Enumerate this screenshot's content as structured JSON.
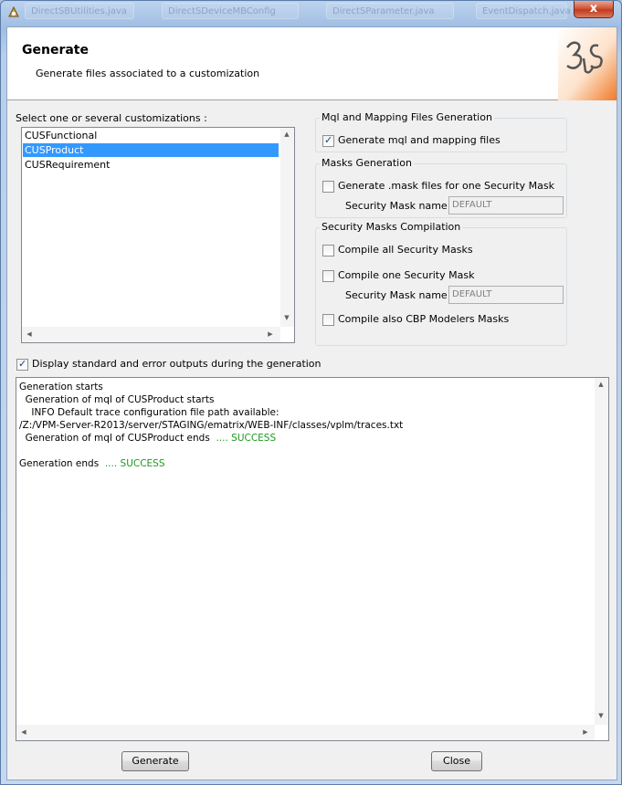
{
  "titlebar": {
    "ghost_tabs": [
      "DirectSBUtilities.java",
      "DirectSDeviceMBConfig",
      "DirectSParameter.java",
      "EventDispatch.java"
    ],
    "close_label": "x"
  },
  "header": {
    "title": "Generate",
    "subtitle": "Generate files associated to a customization",
    "logo_text": "3S"
  },
  "customizations": {
    "label": "Select one or several customizations :",
    "items": [
      {
        "label": "CUSFunctional",
        "selected": false
      },
      {
        "label": "CUSProduct",
        "selected": true
      },
      {
        "label": "CUSRequirement",
        "selected": false
      }
    ]
  },
  "mql_group": {
    "title": "Mql and Mapping Files Generation",
    "generate_label": "Generate mql and mapping files",
    "generate_checked": true
  },
  "masks_group": {
    "title": "Masks Generation",
    "generate_label": "Generate .mask files for one Security Mask",
    "generate_checked": false,
    "mask_name_label": "Security Mask name :",
    "mask_name_value": "DEFAULT"
  },
  "compile_group": {
    "title": "Security Masks Compilation",
    "all_label": "Compile all Security Masks",
    "all_checked": false,
    "one_label": "Compile one Security Mask",
    "one_checked": false,
    "mask_name_label": "Security Mask name :",
    "mask_name_value": "DEFAULT",
    "cbp_label": "Compile also CBP Modelers Masks",
    "cbp_checked": false
  },
  "display_outputs": {
    "label": "Display standard and error outputs during the generation",
    "checked": true
  },
  "console": {
    "lines": [
      {
        "text": "Generation starts",
        "status": ""
      },
      {
        "text": "  Generation of mql of CUSProduct starts",
        "status": ""
      },
      {
        "text": "    INFO Default trace configuration file path available:",
        "status": ""
      },
      {
        "text": "/Z:/VPM-Server-R2013/server/STAGING/ematrix/WEB-INF/classes/vplm/traces.txt",
        "status": ""
      },
      {
        "text": "  Generation of mql of CUSProduct ends  ",
        "status": ".... SUCCESS"
      },
      {
        "text": "",
        "status": ""
      },
      {
        "text": "Generation ends  ",
        "status": ".... SUCCESS"
      }
    ]
  },
  "buttons": {
    "generate": "Generate",
    "close": "Close"
  },
  "colors": {
    "selection": "#3399ff",
    "success": "#1d9a1d",
    "logo_orange": "#f07a28"
  }
}
